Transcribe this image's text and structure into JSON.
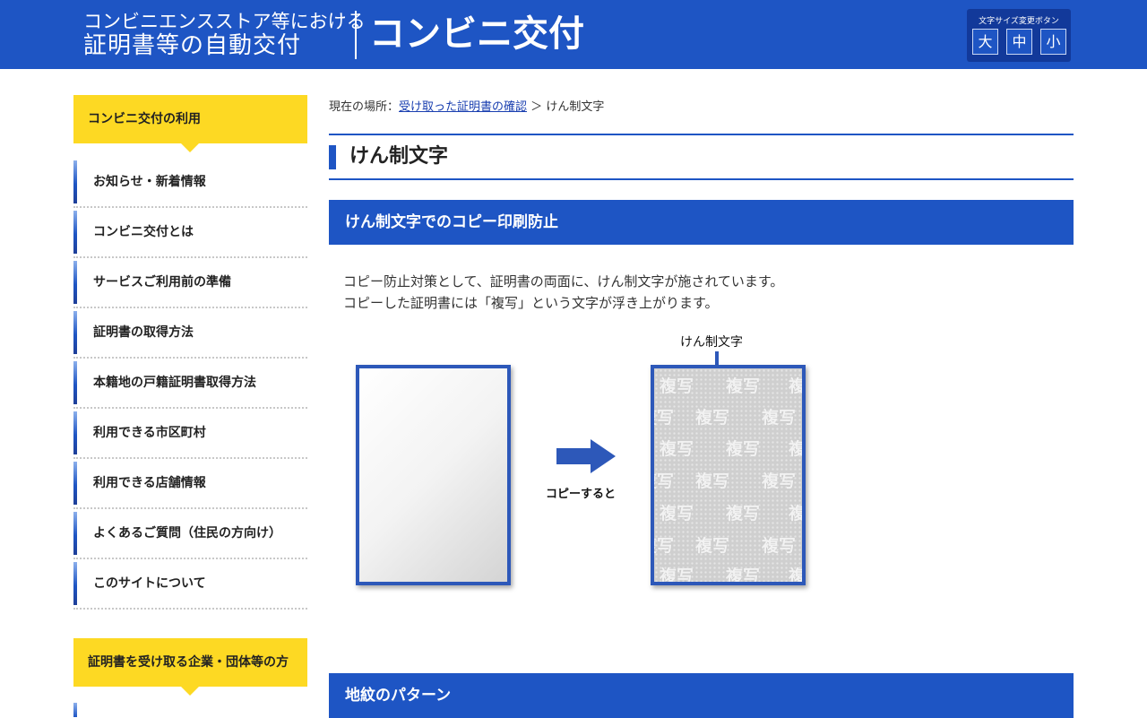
{
  "header": {
    "subtitle_line1": "コンビニエンスストア等における",
    "subtitle_line2": "証明書等の自動交付",
    "title": "コンビニ交付",
    "font_size_title": "文字サイズ変更ボタン",
    "font_size_buttons": [
      "大",
      "中",
      "小"
    ]
  },
  "sidebar": {
    "heading1": "コンビニ交付の利用",
    "items": [
      "お知らせ・新着情報",
      "コンビニ交付とは",
      "サービスご利用前の準備",
      "証明書の取得方法",
      "本籍地の戸籍証明書取得方法",
      "利用できる市区町村",
      "利用できる店舗情報",
      "よくあるご質問（住民の方向け）",
      "このサイトについて"
    ],
    "heading2": "証明書を受け取る企業・団体等の方"
  },
  "breadcrumb": {
    "prefix": "現在の場所：",
    "link": "受け取った証明書の確認",
    "separator": "＞",
    "current": "けん制文字"
  },
  "page": {
    "title": "けん制文字",
    "section1_title": "けん制文字でのコピー印刷防止",
    "para1": "コピー防止対策として、証明書の両面に、けん制文字が施されています。",
    "para2": "コピーした証明書には「複写」という文字が浮き上がります。",
    "section2_title": "地紋のパターン"
  },
  "figure": {
    "callout_label": "けん制文字",
    "arrow_caption": "コピーすると",
    "watermark_text": "複写",
    "frame_color": "#2d58b9"
  },
  "colors": {
    "brand_blue": "#1e55c4",
    "accent_yellow": "#fdd923"
  }
}
